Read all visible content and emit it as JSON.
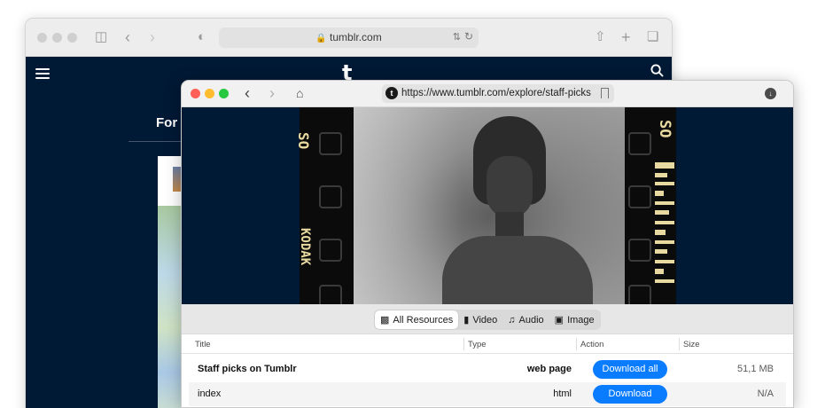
{
  "back_window": {
    "url": "tumblr.com",
    "logo": "t",
    "heading": "For Y"
  },
  "front_window": {
    "url": "https://www.tumblr.com/explore/staff-picks",
    "favicon": "t"
  },
  "film": {
    "left_top": "SO",
    "left_brand": "KODAK",
    "right_top": "SO"
  },
  "filter_tabs": [
    {
      "label": "All Resources",
      "icon": "image-stack-icon",
      "active": true
    },
    {
      "label": "Video",
      "icon": "video-camera-icon",
      "active": false
    },
    {
      "label": "Audio",
      "icon": "music-note-icon",
      "active": false
    },
    {
      "label": "Image",
      "icon": "photo-icon",
      "active": false
    }
  ],
  "table": {
    "columns": [
      "Title",
      "Type",
      "Action",
      "Size"
    ],
    "rows": [
      {
        "title": "Staff picks on Tumblr",
        "type": "web page",
        "action": "Download all",
        "size": "51,1 MB"
      },
      {
        "title": "index",
        "type": "html",
        "action": "Download",
        "size": "N/A"
      }
    ]
  },
  "colors": {
    "tumblr_navy": "#001935",
    "accent_blue": "#0a7cff",
    "close": "#ff5f57",
    "minimize": "#febc2e",
    "zoom": "#28c840"
  }
}
